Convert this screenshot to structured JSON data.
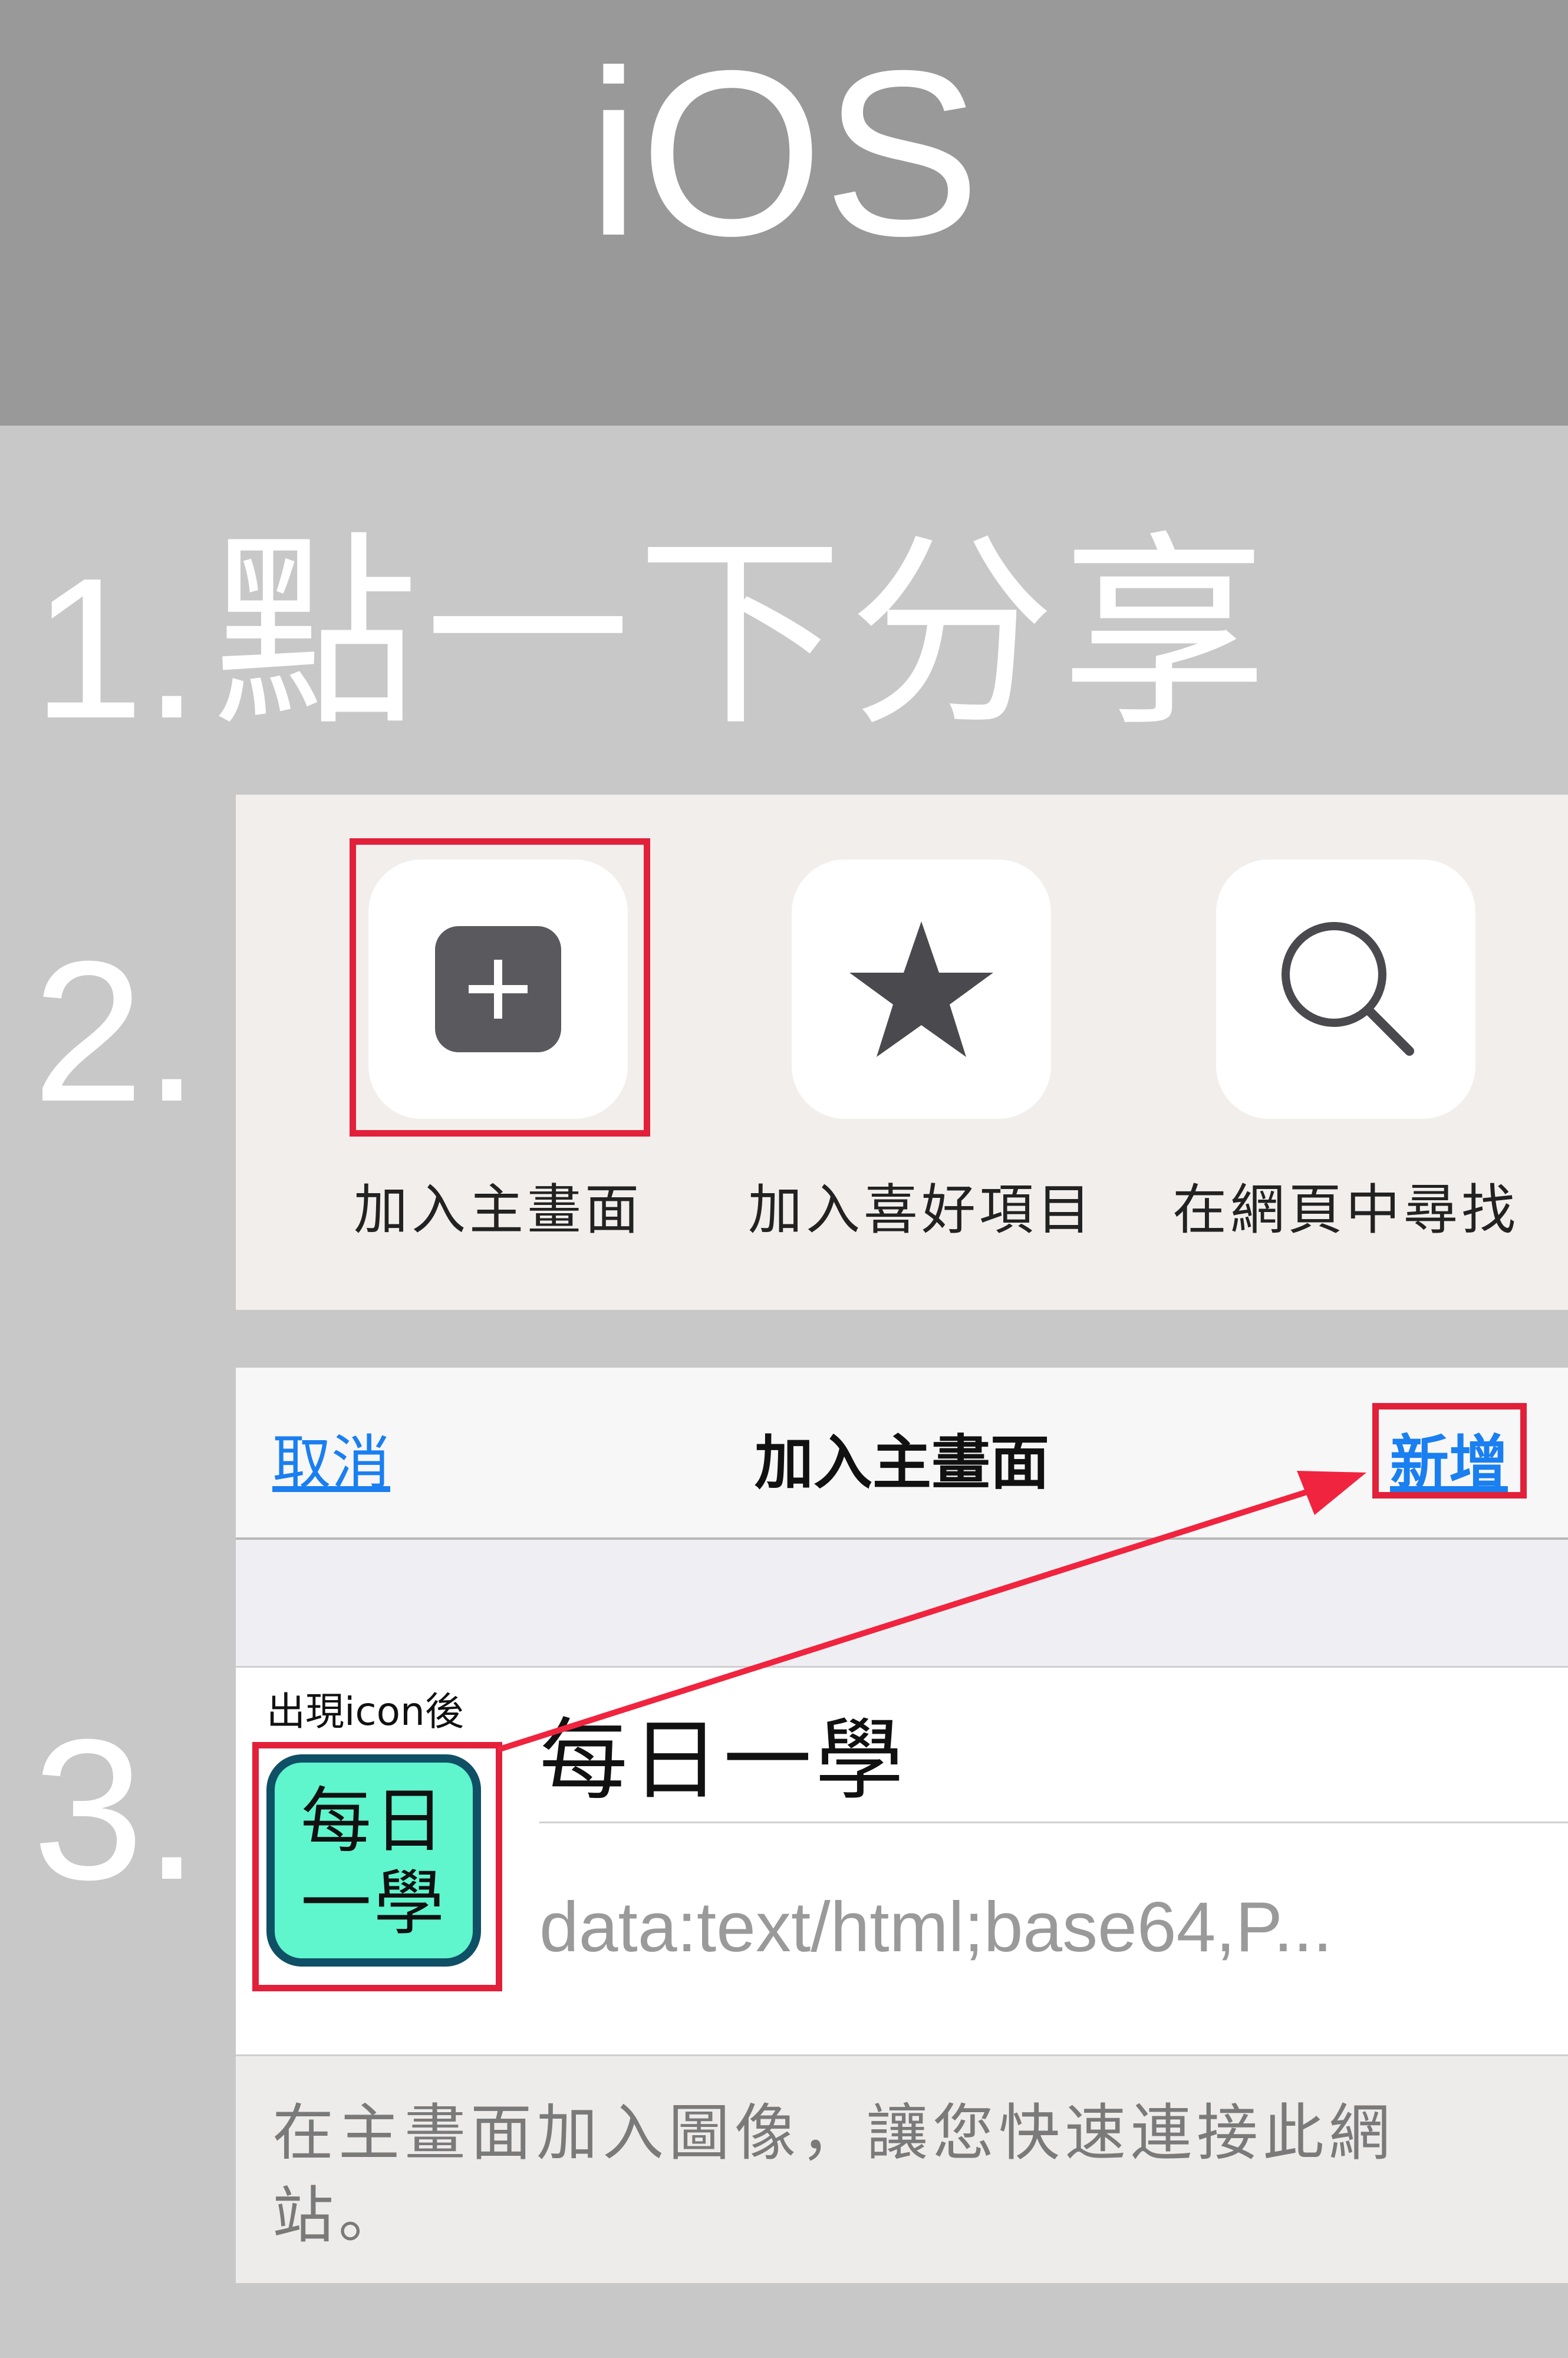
{
  "header": {
    "title": "iOS"
  },
  "steps": {
    "step1": {
      "number": "1.",
      "text": "點一下分享"
    },
    "step2": {
      "number": "2."
    },
    "step3": {
      "number": "3."
    }
  },
  "share_sheet": {
    "items": [
      {
        "label": "加入主畫面",
        "icon": "add-square-icon"
      },
      {
        "label": "加入喜好項目",
        "icon": "star-icon"
      },
      {
        "label": "在網頁中尋找",
        "icon": "search-icon"
      }
    ]
  },
  "add_home": {
    "cancel_label": "取消",
    "title": "加入主畫面",
    "add_label": "新增",
    "icon_note": "出現icon後",
    "icon_text_line1": "每日",
    "icon_text_line2": "一學",
    "app_name": "每日一學",
    "app_url": "data:text/html;base64,P...",
    "footer": "在主畫面加入圖像，讓您快速連接此網站。"
  },
  "colors": {
    "header_bg": "#999999",
    "page_bg": "#c8c8c8",
    "highlight": "#e2203a",
    "link": "#1a7ff0",
    "icon_bg": "#5ff5cd",
    "icon_border": "#0f5066"
  }
}
